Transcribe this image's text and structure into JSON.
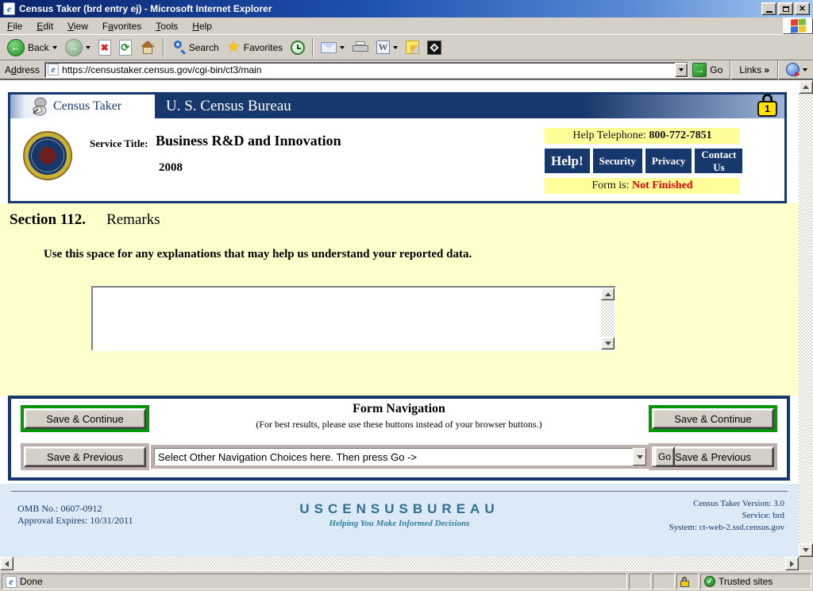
{
  "titlebar": {
    "title": "Census Taker (brd entry ej) - Microsoft Internet Explorer"
  },
  "menubar": {
    "items": [
      {
        "pre": "",
        "u": "F",
        "post": "ile"
      },
      {
        "pre": "",
        "u": "E",
        "post": "dit"
      },
      {
        "pre": "",
        "u": "V",
        "post": "iew"
      },
      {
        "pre": "F",
        "u": "a",
        "post": "vorites"
      },
      {
        "pre": "",
        "u": "T",
        "post": "ools"
      },
      {
        "pre": "",
        "u": "H",
        "post": "elp"
      }
    ]
  },
  "toolbar": {
    "back_label": "Back",
    "search_label": "Search",
    "favorites_label": "Favorites"
  },
  "addressbar": {
    "label_pre": "A",
    "label_u": "d",
    "label_post": "dress",
    "url": "https://censustaker.census.gov/cgi-bin/ct3/main",
    "go_label": "Go",
    "links_label": "Links",
    "links_chevron": "»"
  },
  "banner": {
    "app_name": "Census Taker",
    "org_name": "U. S. Census Bureau",
    "lock_badge": "1"
  },
  "service": {
    "label": "Service Title:",
    "title": "Business R&D and Innovation",
    "year": "2008"
  },
  "helpbox": {
    "telephone_label": "Help Telephone: ",
    "telephone_number": "800-772-7851",
    "buttons": [
      "Help!",
      "Security",
      "Privacy",
      "Contact Us"
    ],
    "form_status_label": "Form is: ",
    "form_status_value": "Not Finished"
  },
  "section": {
    "number": "Section 112.",
    "title": "Remarks",
    "instruction": "Use this space for any explanations that may help us understand your reported data."
  },
  "formnav": {
    "title": "Form Navigation",
    "subtitle": "(For best results, please use these buttons instead of your browser buttons.)",
    "save_continue_label": "Save & Continue",
    "save_previous_label": "Save & Previous",
    "dropdown_value": "Select Other Navigation Choices here. Then press Go ->",
    "go_label": "Go"
  },
  "footer": {
    "omb_line1": "OMB No.: 0607-0912",
    "omb_line2": "Approval Expires: 10/31/2011",
    "logo_text": "USCENSUSBUREAU",
    "tagline": "Helping You Make Informed Decisions",
    "version_line1": "Census Taker Version: 3.0",
    "version_line2": "Service: brd",
    "version_line3": "System: ct-web-2.ssd.census.gov"
  },
  "statusbar": {
    "status_text": "Done",
    "zone_text": "Trusted sites"
  }
}
